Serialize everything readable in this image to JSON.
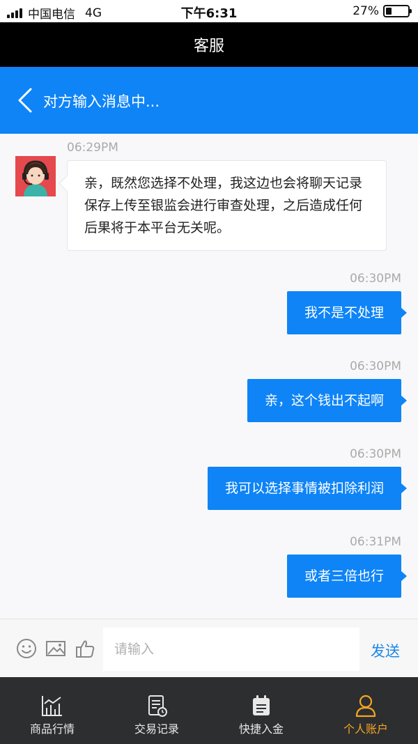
{
  "status_bar": {
    "carrier": "中国电信",
    "network": "4G",
    "time": "下午6:31",
    "battery": "27%",
    "battery_level": 0.27
  },
  "title_bar": {
    "title": "客服"
  },
  "chat_header": {
    "back_icon": "chevron-left-icon",
    "status_text": "对方输入消息中..."
  },
  "messages": [
    {
      "time": "06:29PM",
      "direction": "incoming",
      "text": "亲，既然您选择不处理，我这边也会将聊天记录保存上传至银监会进行审查处理，之后造成任何后果将于本平台无关呢。"
    },
    {
      "time": "06:30PM",
      "direction": "outgoing",
      "text": "我不是不处理"
    },
    {
      "time": "06:30PM",
      "direction": "outgoing",
      "text": "亲，这个钱出不起啊"
    },
    {
      "time": "06:30PM",
      "direction": "outgoing",
      "text": "我可以选择事情被扣除利润"
    },
    {
      "time": "06:31PM",
      "direction": "outgoing",
      "text": "或者三倍也行"
    }
  ],
  "input_bar": {
    "placeholder": "请输入",
    "value": "",
    "send_label": "发送",
    "icons": [
      "emoji-icon",
      "image-icon",
      "thumbs-up-icon"
    ]
  },
  "bottom_nav": [
    {
      "label": "商品行情",
      "icon": "market-chart-icon",
      "active": false
    },
    {
      "label": "交易记录",
      "icon": "records-icon",
      "active": false
    },
    {
      "label": "快捷入金",
      "icon": "deposit-icon",
      "active": false
    },
    {
      "label": "个人账户",
      "icon": "user-icon",
      "active": true
    }
  ],
  "colors": {
    "accent": "#0e84f7",
    "active_tab": "#f5a623",
    "nav_bg": "#2d2e30"
  }
}
